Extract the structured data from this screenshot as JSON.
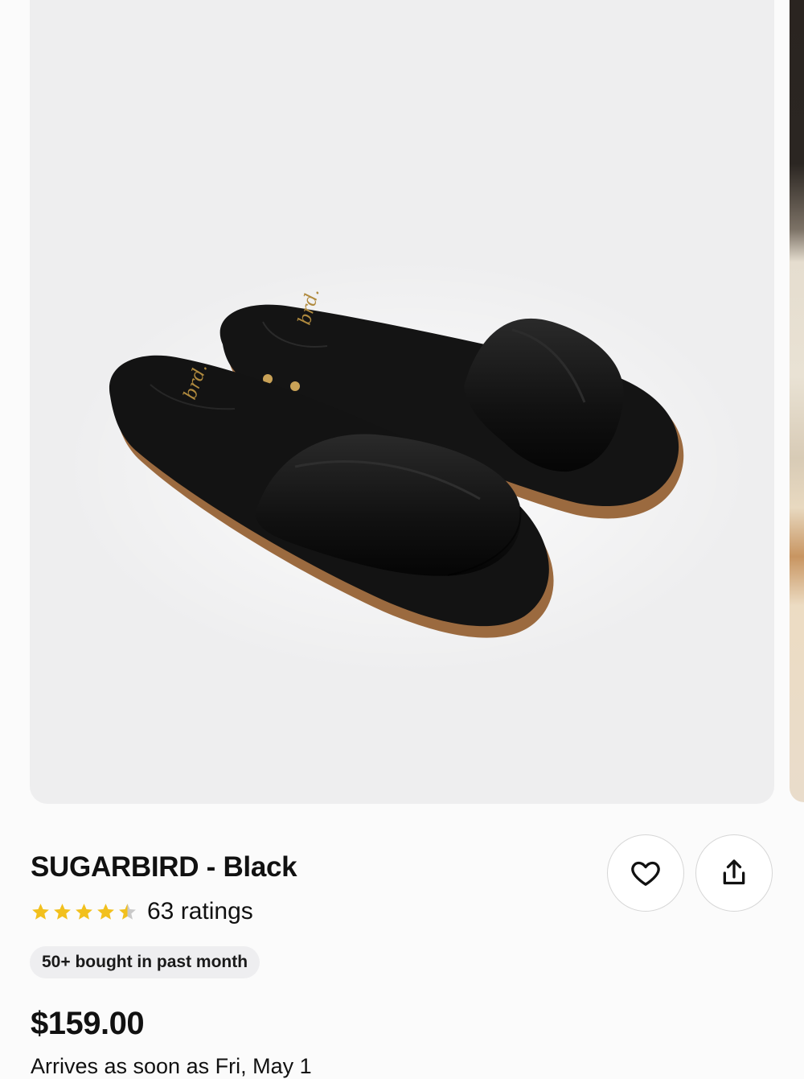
{
  "product": {
    "title": "SUGARBIRD - Black",
    "rating_value": 4.5,
    "rating_max": 5,
    "rating_count_text": "63 ratings",
    "bought_badge": "50+ bought in past month",
    "price": "$159.00",
    "delivery": "Arrives as soon as Fri, May 1"
  },
  "image": {
    "subject": "product-photo-black-slide-sandals",
    "insole_logo": "brand-script-logo"
  },
  "actions": {
    "favorite_icon": "heart-icon",
    "share_icon": "share-icon"
  },
  "colors": {
    "star_filled": "#f2c01d",
    "star_empty": "#c9c9c9",
    "image_background": "#eeeeef",
    "badge_background": "#eeeef0"
  }
}
